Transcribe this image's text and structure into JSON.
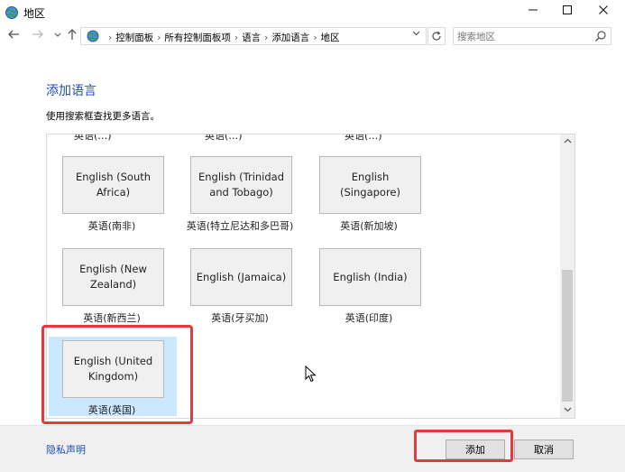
{
  "window": {
    "title": "地区",
    "minimize_icon": "minimize-icon",
    "maximize_icon": "maximize-icon",
    "close_icon": "close-icon"
  },
  "nav": {
    "back_icon": "back-arrow-icon",
    "forward_icon": "forward-arrow-icon",
    "up_icon": "up-arrow-icon",
    "breadcrumbs": [
      "控制面板",
      "所有控制面板项",
      "语言",
      "添加语言",
      "地区"
    ],
    "search_placeholder": "搜索地区"
  },
  "main": {
    "title": "添加语言",
    "hint": "使用搜索框查找更多语言。",
    "partial_row_labels": [
      "英语(…)",
      "英语(…)",
      "英语(…)"
    ],
    "languages": [
      {
        "name": "English (South Africa)",
        "label": "英语(南非)"
      },
      {
        "name": "English (Trinidad and Tobago)",
        "label": "英语(特立尼达和多巴哥)"
      },
      {
        "name": "English (Singapore)",
        "label": "英语(新加坡)"
      },
      {
        "name": "English (New Zealand)",
        "label": "英语(新西兰)"
      },
      {
        "name": "English (Jamaica)",
        "label": "英语(牙买加)"
      },
      {
        "name": "English (India)",
        "label": "英语(印度)"
      },
      {
        "name": "English (United Kingdom)",
        "label": "英语(英国)",
        "selected": true
      }
    ]
  },
  "footer": {
    "privacy": "隐私声明",
    "add_label": "添加",
    "cancel_label": "取消"
  },
  "colors": {
    "link": "#1e4fb5",
    "selection": "#cce8ff",
    "annotation": "#e23b3b"
  }
}
